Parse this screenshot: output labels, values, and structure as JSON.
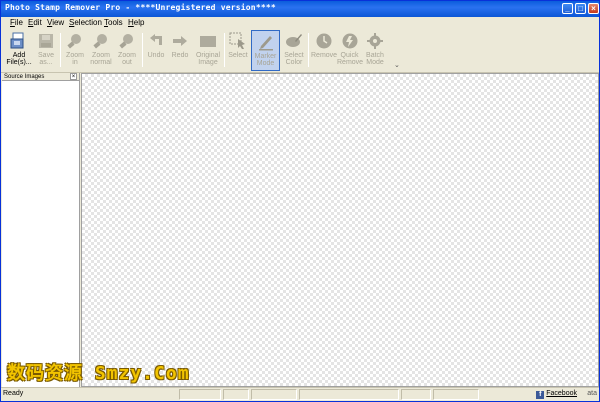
{
  "window": {
    "title": "Photo Stamp Remover Pro - ****Unregistered version****",
    "controls": {
      "minimize": "_",
      "maximize": "□",
      "close": "×"
    }
  },
  "menu": [
    {
      "label": "File",
      "underline": "F",
      "rest": "ile"
    },
    {
      "label": "Edit",
      "underline": "E",
      "rest": "dit"
    },
    {
      "label": "View",
      "underline": "V",
      "rest": "iew"
    },
    {
      "label": "Selection",
      "underline": "S",
      "rest": "election"
    },
    {
      "label": "Tools",
      "underline": "T",
      "rest": "ools"
    },
    {
      "label": "Help",
      "underline": "H",
      "rest": "elp"
    }
  ],
  "toolbar": {
    "add_files": "Add\nFile(s)...",
    "save_as": "Save\nas...",
    "zoom_in": "Zoom\nin",
    "zoom_normal": "Zoom\nnormal",
    "zoom_out": "Zoom\nout",
    "undo": "Undo",
    "redo": "Redo",
    "original_image": "Original\nImage",
    "select": "Select",
    "marker_mode": "Marker\nMode",
    "select_color": "Select\nColor",
    "remove": "Remove",
    "quick_remove": "Quick\nRemove",
    "batch_mode": "Batch\nMode",
    "overflow": "⌄"
  },
  "left_panel": {
    "title": "Source Images",
    "close": "×"
  },
  "watermark": "数码资源 Smzy.Com",
  "status": {
    "text": "Ready",
    "facebook": "Facebook",
    "facebook_icon": "f",
    "end_text": "ata"
  },
  "colors": {
    "accent": "#316ac5",
    "title_bar": "#0a5ddc",
    "watermark": "#f2c400"
  }
}
